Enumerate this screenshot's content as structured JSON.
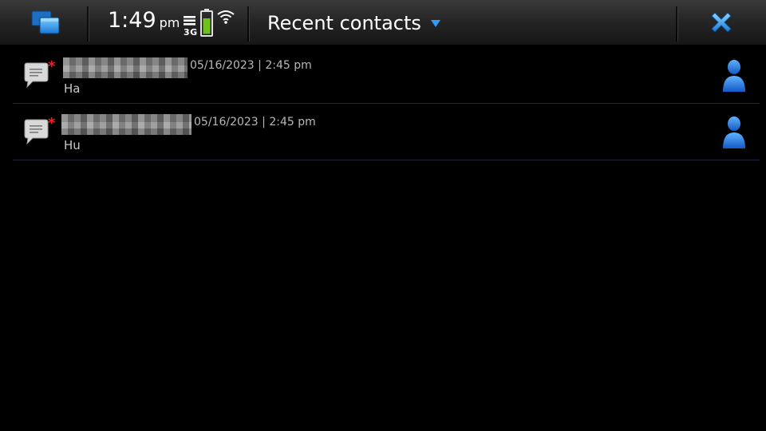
{
  "status_bar": {
    "time": "1:49",
    "ampm": "pm",
    "network": "3G",
    "icons": [
      "signal-bars-icon",
      "battery-icon",
      "wifi-icon"
    ]
  },
  "header": {
    "title": "Recent contacts",
    "menu_icon": "chevron-down-icon",
    "close_icon": "close-icon",
    "task_switcher_icon": "task-switcher-icon"
  },
  "colors": {
    "accent": "#2e9bff",
    "unread_marker": "#e8262a",
    "background": "#000000",
    "divider": "#22223a"
  },
  "contacts": [
    {
      "name_redacted": true,
      "date": "05/16/2023",
      "time": "2:45 pm",
      "preview": "Ha",
      "icon": "unread-message-icon",
      "avatar_icon": "contact-avatar-icon"
    },
    {
      "name_redacted": true,
      "date": "05/16/2023",
      "time": "2:45 pm",
      "preview": "Hu",
      "icon": "unread-message-icon",
      "avatar_icon": "contact-avatar-icon"
    }
  ]
}
